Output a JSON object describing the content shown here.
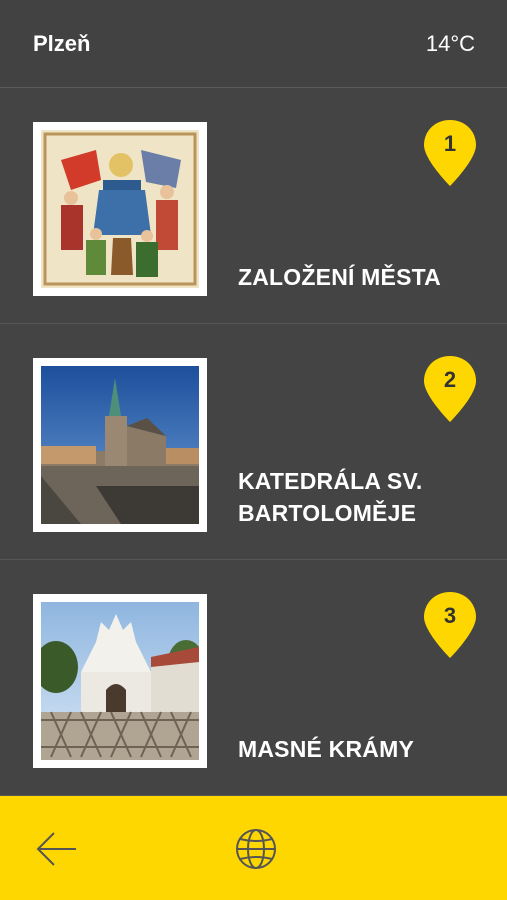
{
  "header": {
    "city": "Plzeň",
    "temperature": "14°C"
  },
  "places": [
    {
      "number": "1",
      "title": "ZALOŽENÍ MĚSTA"
    },
    {
      "number": "2",
      "title": "KATEDRÁLA SV. BARTOLOMĚJE"
    },
    {
      "number": "3",
      "title": "MASNÉ KRÁMY"
    }
  ],
  "colors": {
    "background": "#444444",
    "accent": "#ffd700",
    "text": "#ffffff"
  },
  "icons": {
    "back": "arrow-left-icon",
    "language": "globe-icon",
    "pin": "map-pin-icon"
  }
}
